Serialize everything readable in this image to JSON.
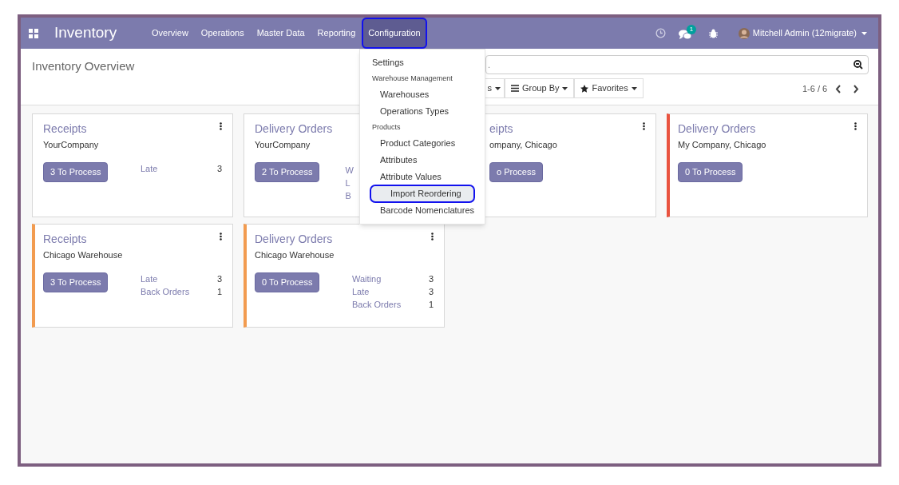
{
  "navbar": {
    "app_name": "Inventory",
    "menus": [
      {
        "label": "Overview",
        "selected": false,
        "annotated": false
      },
      {
        "label": "Operations",
        "selected": false,
        "annotated": false
      },
      {
        "label": "Master Data",
        "selected": false,
        "annotated": false
      },
      {
        "label": "Reporting",
        "selected": false,
        "annotated": false
      },
      {
        "label": "Configuration",
        "selected": true,
        "annotated": true
      }
    ],
    "messages_badge": "1",
    "user": "Mitchell Admin (12migrate)"
  },
  "page_title": "Inventory Overview",
  "search": {
    "placeholder": "."
  },
  "filters": {
    "filters_label": "s",
    "group_by": "Group By",
    "favorites": "Favorites"
  },
  "pager": "1-6 / 6",
  "config_menu": [
    {
      "kind": "item",
      "label": "Settings",
      "selected": false,
      "annotated": false
    },
    {
      "kind": "header",
      "label": "Warehouse Management"
    },
    {
      "kind": "item",
      "label": "Warehouses",
      "selected": false,
      "annotated": false
    },
    {
      "kind": "item",
      "label": "Operations Types",
      "selected": false,
      "annotated": false
    },
    {
      "kind": "header",
      "label": "Products"
    },
    {
      "kind": "item",
      "label": "Product Categories",
      "selected": false,
      "annotated": false
    },
    {
      "kind": "item",
      "label": "Attributes",
      "selected": false,
      "annotated": false
    },
    {
      "kind": "item",
      "label": "Attribute Values",
      "selected": false,
      "annotated": false
    },
    {
      "kind": "item",
      "label": "Import Reordering",
      "selected": true,
      "annotated": true
    },
    {
      "kind": "item",
      "label": "Barcode Nomenclatures",
      "selected": false,
      "annotated": false
    }
  ],
  "cards": [
    {
      "kind": "full",
      "title": "Receipts",
      "subtitle": "YourCompany",
      "button": "3 To Process",
      "stats": [
        {
          "label": "Late",
          "value": "3"
        }
      ]
    },
    {
      "kind": "full",
      "title": "Delivery Orders",
      "subtitle": "YourCompany",
      "button": "2 To Process",
      "stats": [
        {
          "label": "W"
        },
        {
          "label": "L"
        },
        {
          "label": "B"
        }
      ]
    },
    {
      "kind": "partial",
      "title": "eipts",
      "subtitle": "ompany, Chicago",
      "button": "o Process"
    },
    {
      "kind": "full",
      "title": "Delivery Orders",
      "subtitle": "My Company, Chicago",
      "button": "0 To Process",
      "color": "#e9533f"
    },
    {
      "kind": "full",
      "title": "Receipts",
      "subtitle": "Chicago Warehouse",
      "button": "3 To Process",
      "color": "#f29b4f",
      "stats": [
        {
          "label": "Late",
          "value": "3"
        },
        {
          "label": "Back Orders",
          "value": "1"
        }
      ]
    },
    {
      "kind": "full",
      "title": "Delivery Orders",
      "subtitle": "Chicago Warehouse",
      "button": "0 To Process",
      "color": "#f29b4f",
      "stats": [
        {
          "label": "Waiting",
          "value": "3"
        },
        {
          "label": "Late",
          "value": "3"
        },
        {
          "label": "Back Orders",
          "value": "1"
        }
      ]
    }
  ]
}
